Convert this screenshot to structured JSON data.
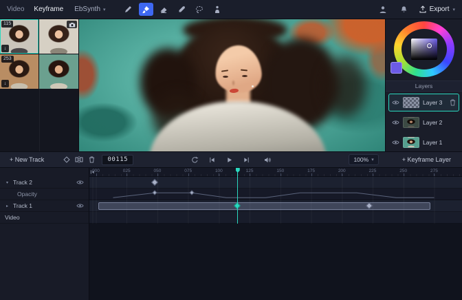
{
  "icons": {
    "chevron_down": "▾",
    "caret_down": "▾",
    "caret_right": "▸",
    "download": "↓"
  },
  "topbar": {
    "tabs": [
      {
        "label": "Video"
      },
      {
        "label": "Keyframe"
      }
    ],
    "engine_select": {
      "value": "EbSynth"
    },
    "tools": [
      "pencil",
      "brush",
      "eraser",
      "eyedropper",
      "lasso",
      "pose"
    ],
    "active_tool": "brush",
    "export_label": "Export"
  },
  "keyframes_panel": {
    "thumbnails": [
      {
        "badge": "115",
        "selected": true,
        "download": true
      },
      {
        "camera": true
      },
      {
        "badge": "253",
        "download": true
      },
      {}
    ]
  },
  "color_panel": {
    "current_color": "#6c5be6"
  },
  "layers_panel": {
    "title": "Layers",
    "layers": [
      {
        "name": "Layer 3",
        "selected": true
      },
      {
        "name": "Layer 2",
        "selected": false
      },
      {
        "name": "Layer 1",
        "selected": false
      }
    ]
  },
  "controls": {
    "new_track_label": "+ New Track",
    "frame_counter": "00115",
    "zoom_value": "100%",
    "keyframe_layer_label": "+ Keyframe Layer"
  },
  "timeline": {
    "ruler_ticks": [
      "000",
      "025",
      "050",
      "075",
      "100",
      "125",
      "150",
      "175",
      "200",
      "225",
      "250",
      "275"
    ],
    "playhead_frame": 115,
    "tracks": [
      {
        "name": "Track 2",
        "expanded": true,
        "eye": true
      },
      {
        "name": "Opacity",
        "sub": true
      },
      {
        "name": "Track 1",
        "expanded": false,
        "eye": true
      },
      {
        "name": "Video"
      }
    ],
    "track2_keyframes": [
      48
    ],
    "track1_keyframes": [
      222
    ],
    "track1_playhead_keyframe": 115,
    "track1_bar": {
      "start": 2,
      "end": 272
    },
    "opacity_envelope": [
      [
        14,
        0.12
      ],
      [
        48,
        0.82
      ],
      [
        78,
        0.82
      ],
      [
        106,
        0.12
      ],
      [
        138,
        0.12
      ],
      [
        166,
        0.82
      ],
      [
        212,
        0.82
      ],
      [
        244,
        0.12
      ],
      [
        275,
        0.12
      ]
    ],
    "opacity_diamonds": [
      48,
      78
    ],
    "accent_teal": "#2bd9c0"
  }
}
